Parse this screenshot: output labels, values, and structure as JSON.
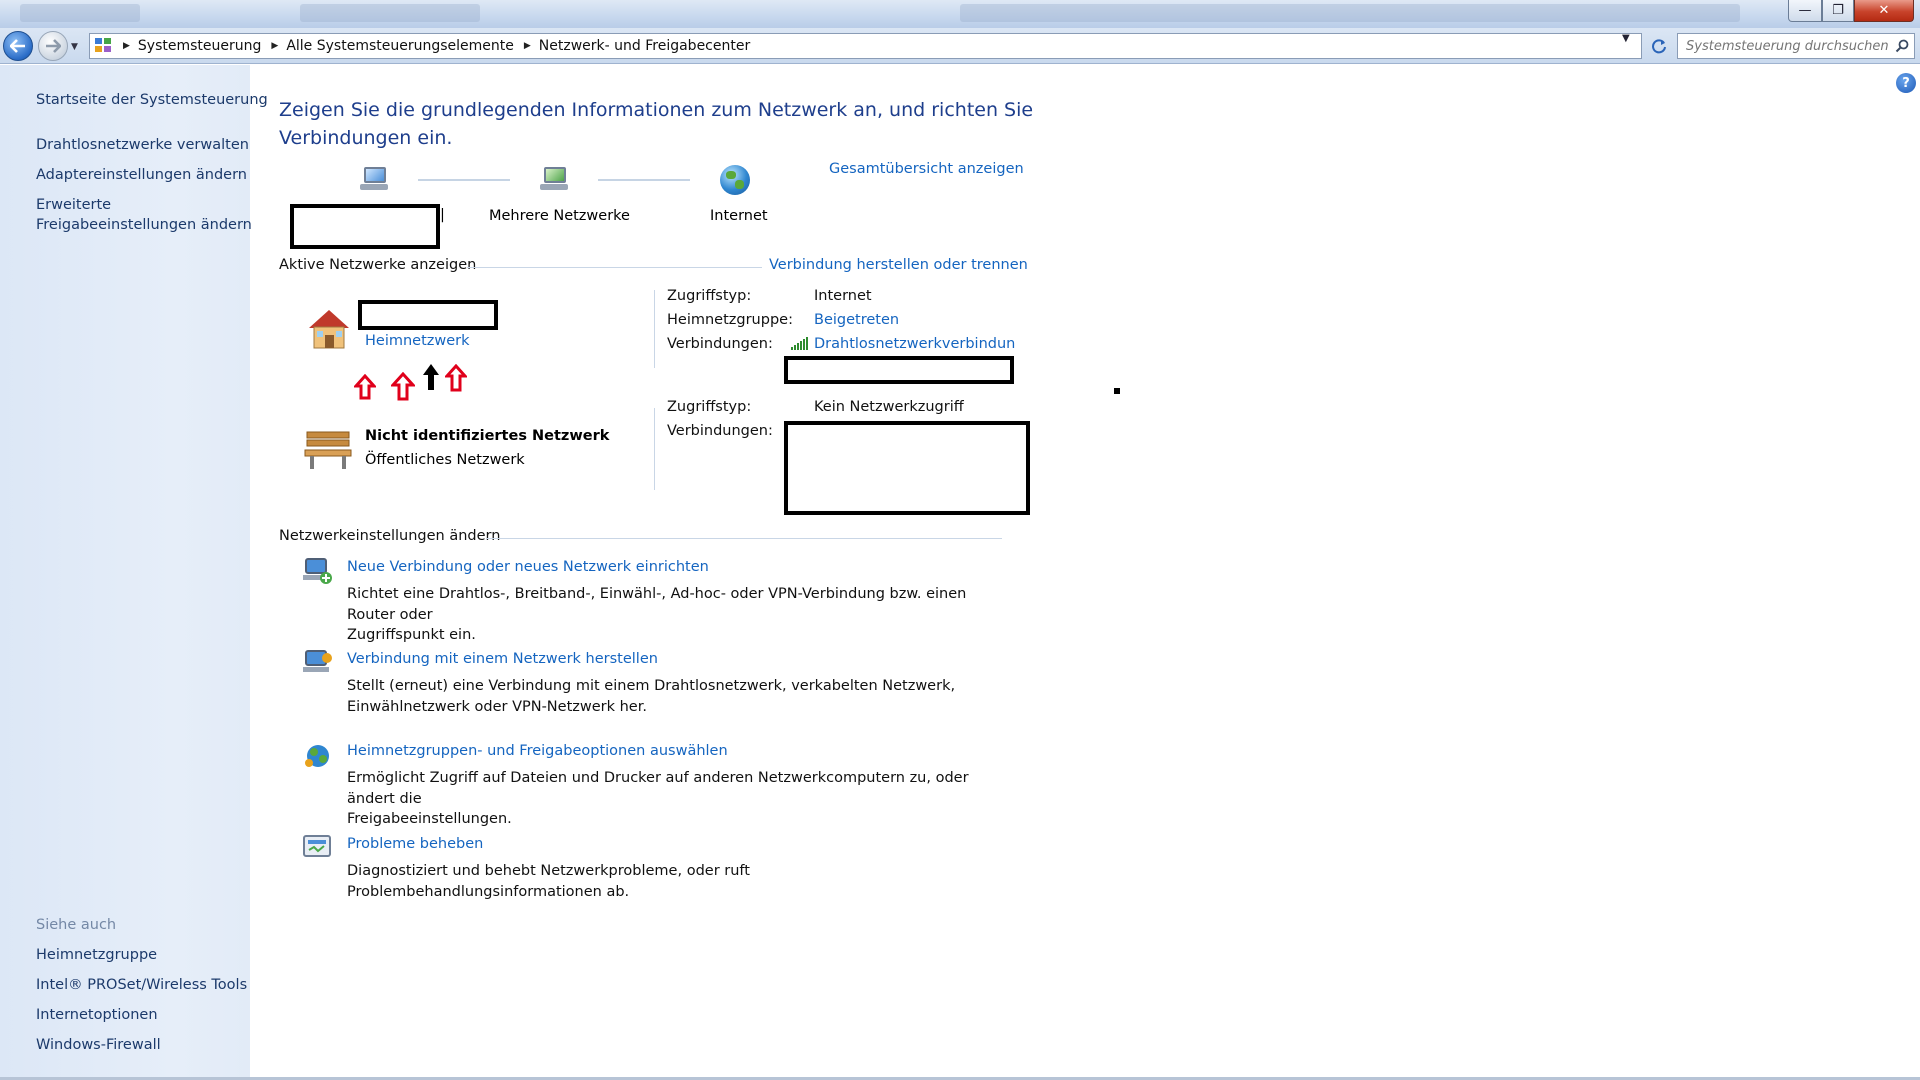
{
  "window": {
    "minimize_glyph": "—",
    "maximize_glyph": "❐",
    "close_glyph": "✕"
  },
  "address_bar": {
    "breadcrumbs": [
      "Systemsteuerung",
      "Alle Systemsteuerungselemente",
      "Netzwerk- und Freigabecenter"
    ],
    "search_placeholder": "Systemsteuerung durchsuchen"
  },
  "sidebar": {
    "home_link": "Startseite der Systemsteuerung",
    "tasks": [
      "Drahtlosnetzwerke verwalten",
      "Adaptereinstellungen ändern",
      "Erweiterte",
      "Freigabeeinstellungen ändern"
    ],
    "see_also_title": "Siehe auch",
    "see_also": [
      "Heimnetzgruppe",
      "Intel® PROSet/Wireless Tools",
      "Internetoptionen",
      "Windows-Firewall"
    ]
  },
  "main": {
    "title": "Zeigen Sie die grundlegenden Informationen zum Netzwerk an, und richten Sie Verbindungen ein.",
    "full_map_link": "Gesamtübersicht anzeigen",
    "map": {
      "node_middle": "Mehrere Netzwerke",
      "node_right": "Internet"
    },
    "active_networks": {
      "heading": "Aktive Netzwerke anzeigen",
      "connect_link": "Verbindung herstellen oder trennen",
      "network1": {
        "type_link": "Heimnetzwerk",
        "access_label": "Zugriffstyp:",
        "access_value": "Internet",
        "homegroup_label": "Heimnetzgruppe:",
        "homegroup_value": "Beigetreten",
        "connections_label": "Verbindungen:",
        "connections_value": "Drahtlosnetzwerkverbindun"
      },
      "network2": {
        "name": "Nicht identifiziertes Netzwerk",
        "type": "Öffentliches Netzwerk",
        "access_label": "Zugriffstyp:",
        "access_value": "Kein Netzwerkzugriff",
        "connections_label": "Verbindungen:"
      }
    },
    "change_settings": {
      "heading": "Netzwerkeinstellungen ändern",
      "tasks": [
        {
          "title": "Neue Verbindung oder neues Netzwerk einrichten",
          "desc_line1": "Richtet eine Drahtlos-, Breitband-, Einwähl-, Ad-hoc- oder VPN-Verbindung bzw. einen Router oder",
          "desc_line2": "Zugriffspunkt ein."
        },
        {
          "title": "Verbindung mit einem Netzwerk herstellen",
          "desc_line1": "Stellt (erneut) eine Verbindung mit einem Drahtlosnetzwerk, verkabelten Netzwerk,",
          "desc_line2": "Einwählnetzwerk oder VPN-Netzwerk her."
        },
        {
          "title": "Heimnetzgruppen- und Freigabeoptionen auswählen",
          "desc_line1": "Ermöglicht Zugriff auf Dateien und Drucker auf anderen Netzwerkcomputern zu, oder ändert die",
          "desc_line2": "Freigabeeinstellungen."
        },
        {
          "title": "Probleme beheben",
          "desc_line1": "Diagnostiziert und behebt Netzwerkprobleme, oder ruft Problembehandlungsinformationen ab.",
          "desc_line2": ""
        }
      ]
    }
  },
  "colors": {
    "link": "#1565c0",
    "title": "#1e3e8c",
    "sidebar_bg": "#dce7f6",
    "annotation_red": "#e0001b"
  }
}
